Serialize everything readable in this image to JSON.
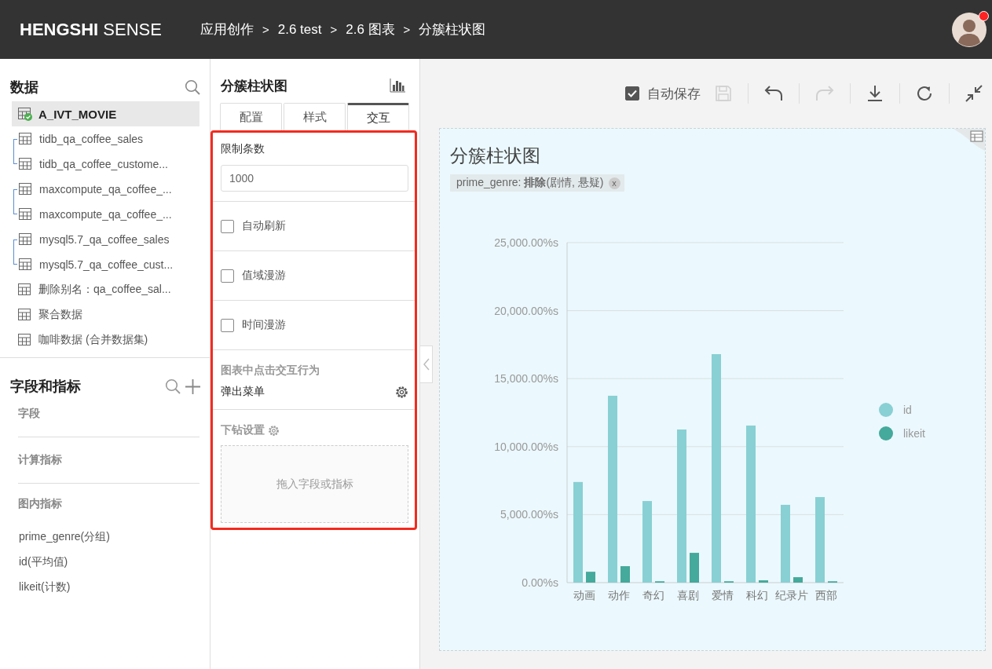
{
  "header": {
    "logo": "**HENGSHI** SENSE",
    "breadcrumb": [
      "应用创作",
      "2.6 test",
      "2.6 图表",
      "分簇柱状图"
    ],
    "separators": [
      ">",
      ">",
      ">"
    ],
    "avatar": {
      "notification": true
    }
  },
  "data_panel": {
    "title": "数据",
    "groups": [
      {
        "kind": "single",
        "items": [
          {
            "name": "A_IVT_MOVIE",
            "selected": true,
            "connected": true
          }
        ]
      },
      {
        "kind": "linked",
        "items": [
          {
            "name": "tidb_qa_coffee_sales",
            "selected": false,
            "connected": false
          },
          {
            "name": "tidb_qa_coffee_custome...",
            "selected": false,
            "connected": false
          }
        ]
      },
      {
        "kind": "linked",
        "items": [
          {
            "name": "maxcompute_qa_coffee_...",
            "selected": false,
            "connected": false
          },
          {
            "name": "maxcompute_qa_coffee_...",
            "selected": false,
            "connected": false
          }
        ]
      },
      {
        "kind": "linked",
        "items": [
          {
            "name": "mysql5.7_qa_coffee_sales",
            "selected": false,
            "connected": false
          },
          {
            "name": "mysql5.7_qa_coffee_cust...",
            "selected": false,
            "connected": false
          }
        ]
      },
      {
        "kind": "single",
        "items": [
          {
            "name": "删除别名：qa_coffee_sal...",
            "selected": false,
            "connected": false
          }
        ]
      },
      {
        "kind": "single",
        "items": [
          {
            "name": "聚合数据",
            "selected": false,
            "connected": false
          }
        ]
      },
      {
        "kind": "single",
        "items": [
          {
            "name": "咖啡数据 (合并数据集)",
            "selected": false,
            "connected": false
          }
        ]
      }
    ]
  },
  "fields_panel": {
    "title": "字段和指标",
    "sections": [
      {
        "label": "字段"
      },
      {
        "label": "计算指标"
      },
      {
        "label": "图内指标",
        "items": [
          "prime_genre(分组)",
          "id(平均值)",
          "likeit(计数)"
        ]
      }
    ]
  },
  "settings_panel": {
    "title": "分簇柱状图",
    "tabs": [
      {
        "label": "配置",
        "selected": false
      },
      {
        "label": "样式",
        "selected": false
      },
      {
        "label": "交互",
        "selected": true
      }
    ],
    "limit": {
      "label": "限制条数",
      "value": "1000"
    },
    "toggles": [
      {
        "label": "自动刷新",
        "checked": false
      },
      {
        "label": "值域漫游",
        "checked": false
      },
      {
        "label": "时间漫游",
        "checked": false
      }
    ],
    "click_behavior": {
      "label": "图表中点击交互行为",
      "value": "弹出菜单"
    },
    "drill": {
      "label": "下钻设置",
      "drop_hint": "拖入字段或指标"
    }
  },
  "toolbar": {
    "autosave": {
      "label": "自动保存",
      "checked": true
    },
    "buttons": [
      {
        "kind": "save",
        "disabled": true
      },
      {
        "kind": "undo",
        "disabled": false
      },
      {
        "kind": "redo",
        "disabled": true
      },
      {
        "kind": "download",
        "disabled": false
      },
      {
        "kind": "refresh",
        "disabled": false
      },
      {
        "kind": "collapse",
        "disabled": false
      }
    ]
  },
  "chart_card": {
    "title": "分簇柱状图",
    "filter": {
      "text": "prime_genre: **排除**(剧情, 悬疑)",
      "remove": "x"
    },
    "chart_data": {
      "type": "bar",
      "categories": [
        "动画",
        "动作",
        "奇幻",
        "喜剧",
        "爱情",
        "科幻",
        "纪录片",
        "西部"
      ],
      "series": [
        {
          "name": "id",
          "color": "#88d0d3",
          "values": [
            7400,
            13740,
            6000,
            11260,
            16800,
            11550,
            5720,
            6290
          ]
        },
        {
          "name": "likeit",
          "color": "#45a99b",
          "values": [
            800,
            1210,
            100,
            2190,
            100,
            170,
            400,
            100
          ]
        }
      ],
      "ylim": [
        0,
        25000
      ],
      "grid": true,
      "legend": "right",
      "yticks": [
        {
          "value": 0,
          "label": "0.00%s"
        },
        {
          "value": 5000,
          "label": "5,000.00%s"
        },
        {
          "value": 10000,
          "label": "10,000.00%s"
        },
        {
          "value": 15000,
          "label": "15,000.00%s"
        },
        {
          "value": 20000,
          "label": "20,000.00%s"
        },
        {
          "value": 25000,
          "label": "25,000.00%s"
        }
      ]
    }
  }
}
